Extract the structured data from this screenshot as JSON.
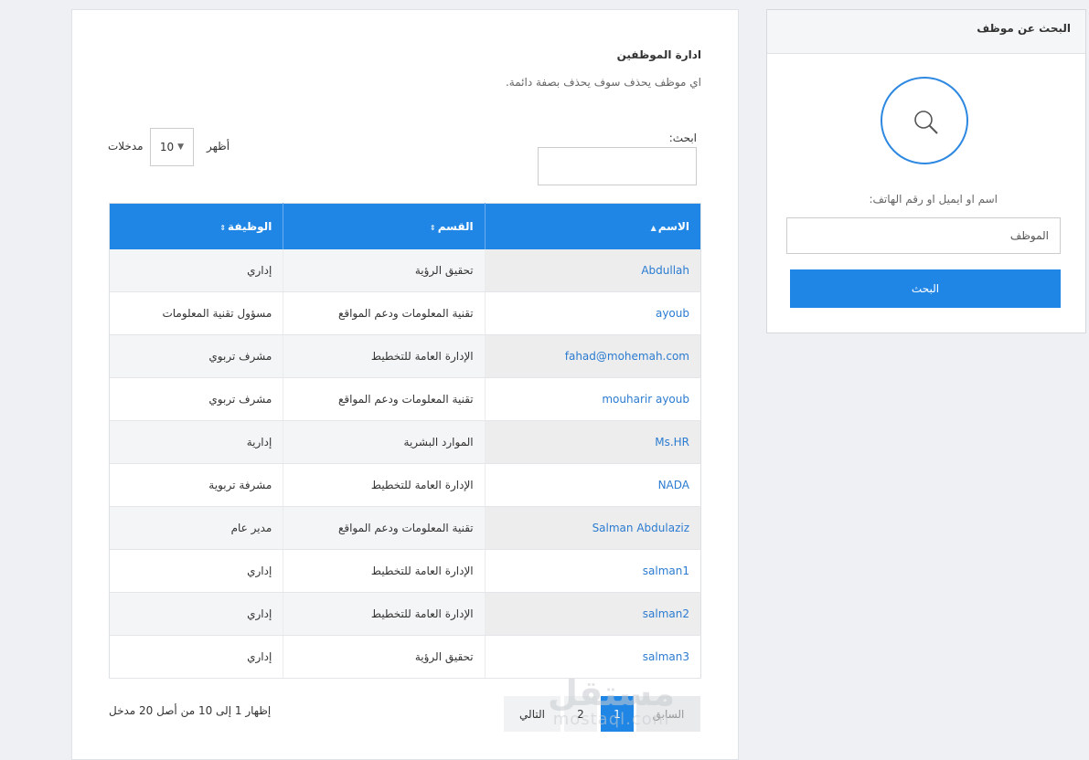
{
  "sidebar": {
    "title": "البحث عن موظف",
    "label": "اسم او ايميل او رقم الهاتف:",
    "input_placeholder": "الموظف",
    "button": "البحث",
    "icon": "search-icon"
  },
  "main": {
    "title": "ادارة الموظفين",
    "subtitle": "اي موظف يحذف سوف يحذف بصفة دائمة.",
    "search_label": "ابحث:",
    "show_label": "أظهر",
    "entries_label": "مدخلات",
    "page_length": "10",
    "columns": [
      "الاسم",
      "القسم",
      "الوظيفة"
    ],
    "rows": [
      {
        "name": "Abdullah",
        "dept": "تحقيق الرؤية",
        "job": "إداري"
      },
      {
        "name": "ayoub",
        "dept": "تقنية المعلومات ودعم المواقع",
        "job": "مسؤول تقنية المعلومات"
      },
      {
        "name": "fahad@mohemah.com",
        "dept": "الإدارة العامة للتخطيط",
        "job": "مشرف تربوي"
      },
      {
        "name": "mouharir ayoub",
        "dept": "تقنية المعلومات ودعم المواقع",
        "job": "مشرف تربوي"
      },
      {
        "name": "Ms.HR",
        "dept": "الموارد البشرية",
        "job": "إدارية"
      },
      {
        "name": "NADA",
        "dept": "الإدارة العامة للتخطيط",
        "job": "مشرفة تربوية"
      },
      {
        "name": "Salman Abdulaziz",
        "dept": "تقنية المعلومات ودعم المواقع",
        "job": "مدير عام"
      },
      {
        "name": "salman1",
        "dept": "الإدارة العامة للتخطيط",
        "job": "إداري"
      },
      {
        "name": "salman2",
        "dept": "الإدارة العامة للتخطيط",
        "job": "إداري"
      },
      {
        "name": "salman3",
        "dept": "تحقيق الرؤية",
        "job": "إداري"
      }
    ],
    "info": "إظهار 1 إلى 10 من أصل 20 مدخل",
    "pagination": {
      "prev": "السابق",
      "page1": "1",
      "page2": "2",
      "next": "التالي"
    }
  },
  "watermark": {
    "arabic": "مستقل",
    "latin": "mostaql.com"
  },
  "colors": {
    "accent": "#1f86e5",
    "link": "#2b7bd0"
  }
}
